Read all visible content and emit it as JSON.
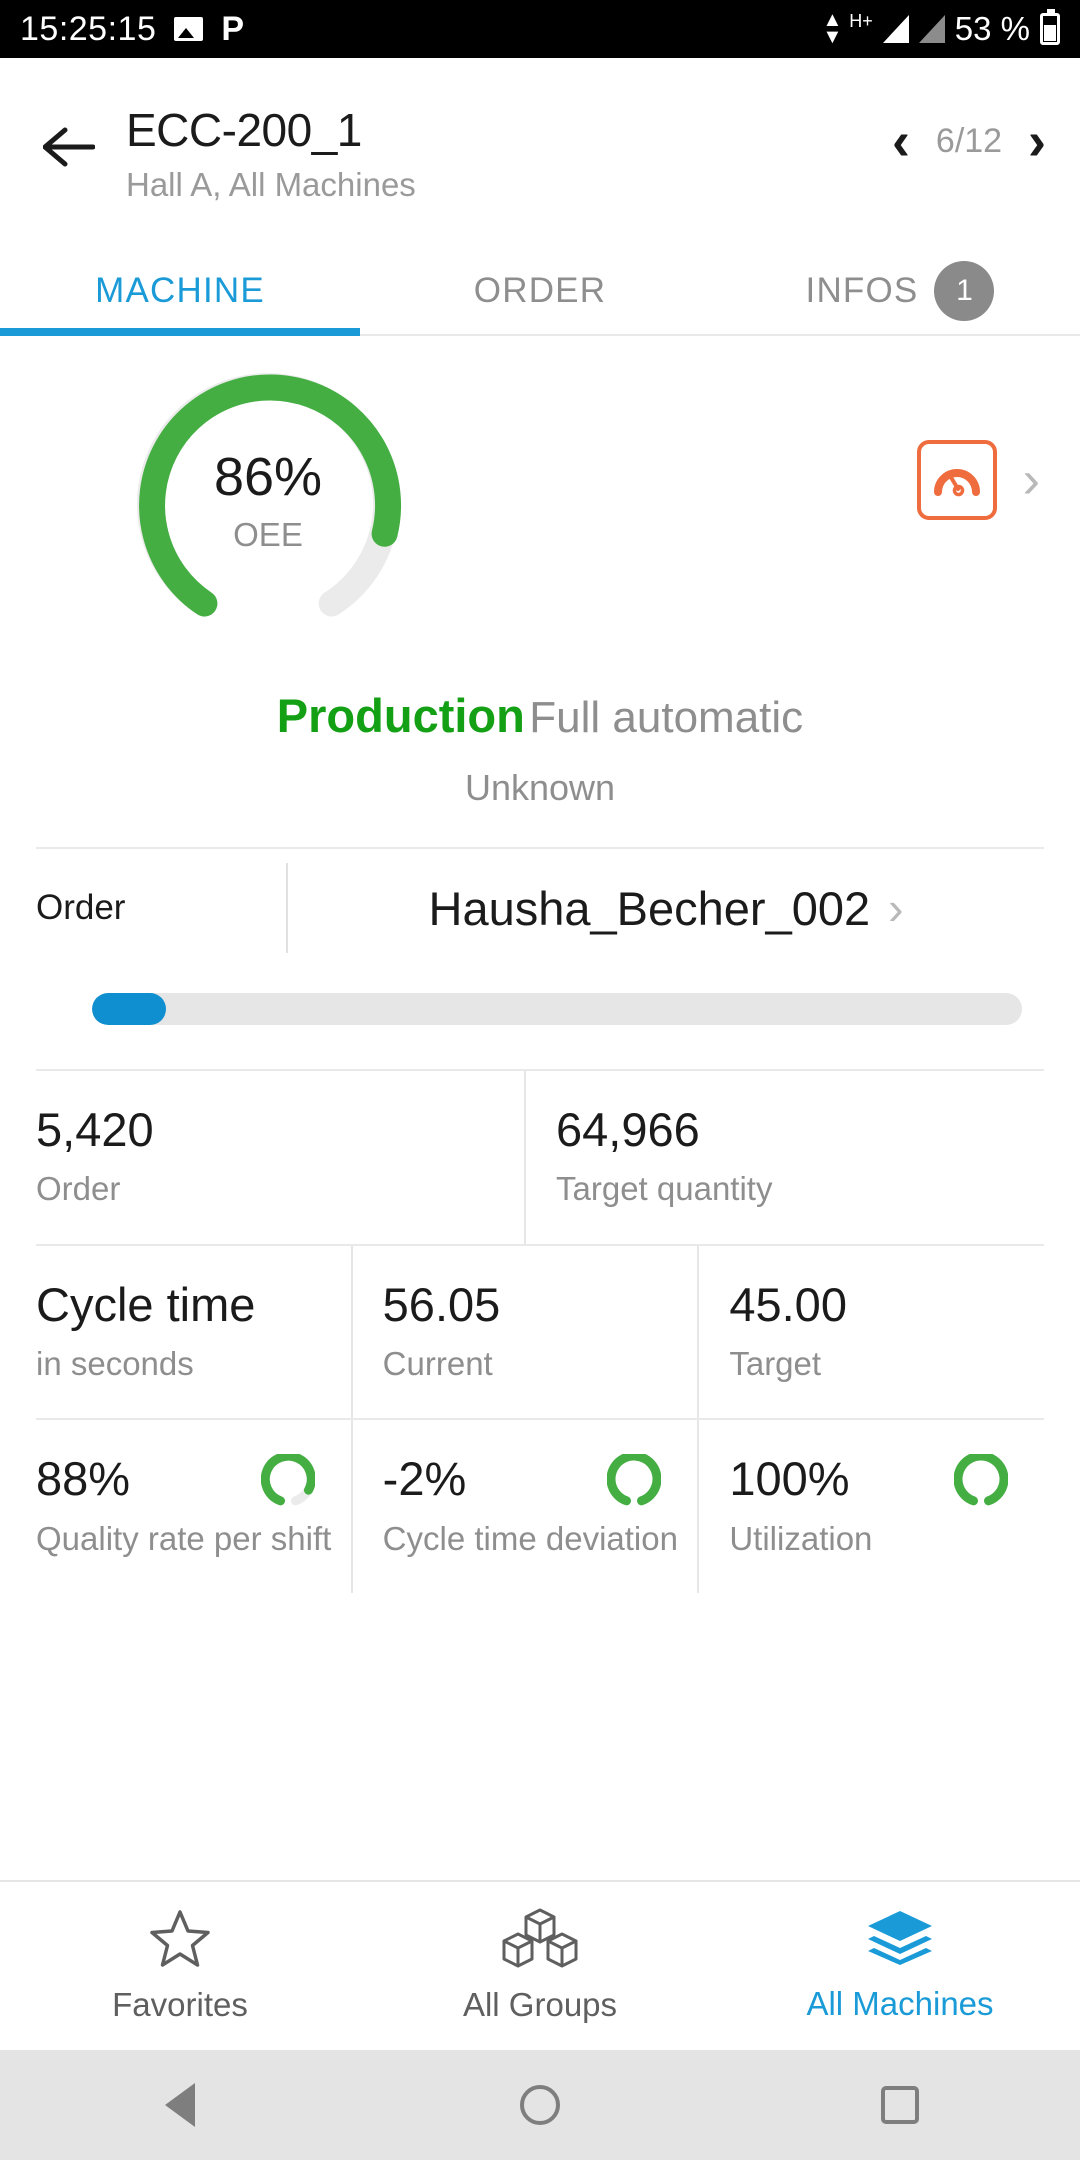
{
  "statusbar": {
    "time": "15:25:15",
    "icons": [
      "image-icon",
      "pocket-icon"
    ],
    "network_hplus": "H+",
    "battery_percent": "53 %"
  },
  "header": {
    "back_icon": "arrow-left-icon",
    "title": "ECC-200_1",
    "subtitle": "Hall A, All Machines",
    "prev_icon": "chevron-left-icon",
    "next_icon": "chevron-right-icon",
    "pager": "6/12"
  },
  "tabs": [
    {
      "label": "MACHINE",
      "active": true,
      "badge": ""
    },
    {
      "label": "ORDER",
      "active": false,
      "badge": ""
    },
    {
      "label": "INFOS",
      "active": false,
      "badge": "1"
    }
  ],
  "oee": {
    "value": "86%",
    "label": "OEE",
    "percent": 86,
    "arc_color": "#44ae43",
    "track_color": "#ebebeb",
    "side_icon": "speedometer-icon",
    "side_icon_color": "#ef6c3e",
    "side_chevron": "›"
  },
  "status": {
    "main": "Production",
    "main_color": "#14a014",
    "sub": "Full automatic",
    "extra": "Unknown"
  },
  "order": {
    "label": "Order",
    "value": "Hausha_Becher_002",
    "chevron": "›",
    "progress_percent": 8,
    "progress_color": "#0f8fd0"
  },
  "quantities": [
    {
      "value": "5,420",
      "label": "Order"
    },
    {
      "value": "64,966",
      "label": "Target quantity"
    }
  ],
  "cycle_time": [
    {
      "value": "Cycle time",
      "label": "in seconds"
    },
    {
      "value": "56.05",
      "label": "Current"
    },
    {
      "value": "45.00",
      "label": "Target"
    }
  ],
  "kpis": [
    {
      "value": "88%",
      "label": "Quality rate per shift",
      "ring_percent": 88,
      "ring_color": "#44ae43"
    },
    {
      "value": "-2%",
      "label": "Cycle time deviation",
      "ring_percent": 100,
      "ring_color": "#44ae43"
    },
    {
      "value": "100%",
      "label": "Utilization",
      "ring_percent": 100,
      "ring_color": "#44ae43"
    }
  ],
  "bottomnav": [
    {
      "label": "Favorites",
      "icon": "star-icon",
      "active": false
    },
    {
      "label": "All Groups",
      "icon": "boxes-icon",
      "active": false
    },
    {
      "label": "All Machines",
      "icon": "layers-icon",
      "active": true
    }
  ],
  "androidnav": {
    "back": "back-triangle-icon",
    "home": "home-circle-icon",
    "recents": "recents-square-icon"
  }
}
